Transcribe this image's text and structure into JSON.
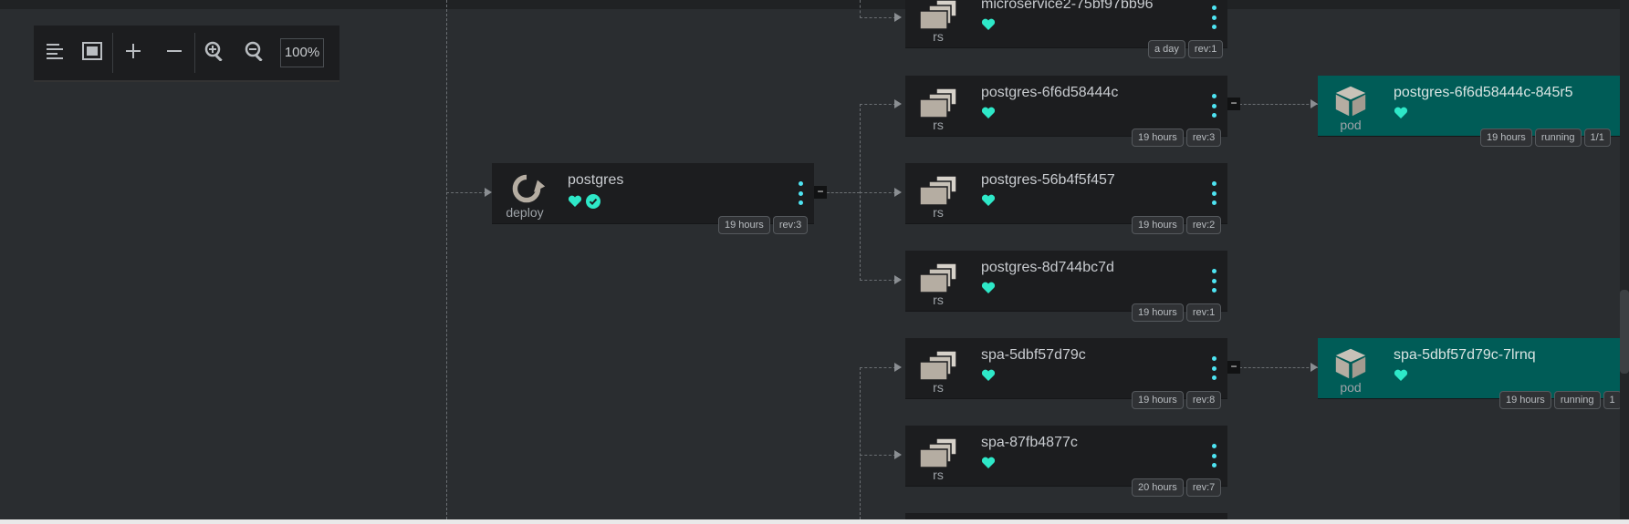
{
  "toolbar": {
    "zoom": "100%",
    "buttons": [
      "align-left-icon",
      "fit-screen-icon",
      "plus-icon",
      "minus-icon",
      "zoom-in-icon",
      "zoom-out-icon"
    ]
  },
  "colors": {
    "accent": "#4ee4f2",
    "health": "#2ee8c8",
    "pod_background": "#005c57",
    "card_background": "#1c1d1f",
    "canvas": "#2a2d30"
  },
  "deploy": {
    "kind": "deploy",
    "name": "postgres",
    "age": "19 hours",
    "rev": "rev:3"
  },
  "replicasets": [
    {
      "kind": "rs",
      "name": "microservice2-75bf97bb96",
      "age": "a day",
      "rev": "rev:1"
    },
    {
      "kind": "rs",
      "name": "postgres-6f6d58444c",
      "age": "19 hours",
      "rev": "rev:3"
    },
    {
      "kind": "rs",
      "name": "postgres-56b4f5f457",
      "age": "19 hours",
      "rev": "rev:2"
    },
    {
      "kind": "rs",
      "name": "postgres-8d744bc7d",
      "age": "19 hours",
      "rev": "rev:1"
    },
    {
      "kind": "rs",
      "name": "spa-5dbf57d79c",
      "age": "19 hours",
      "rev": "rev:8"
    },
    {
      "kind": "rs",
      "name": "spa-87fb4877c",
      "age": "20 hours",
      "rev": "rev:7"
    }
  ],
  "pods": [
    {
      "kind": "pod",
      "name": "postgres-6f6d58444c-845r5",
      "age": "19 hours",
      "status": "running",
      "ready": "1/1"
    },
    {
      "kind": "pod",
      "name": "spa-5dbf57d79c-7lrnq",
      "age": "19 hours",
      "status": "running",
      "ready": "1"
    }
  ],
  "collapse_symbol": "−"
}
